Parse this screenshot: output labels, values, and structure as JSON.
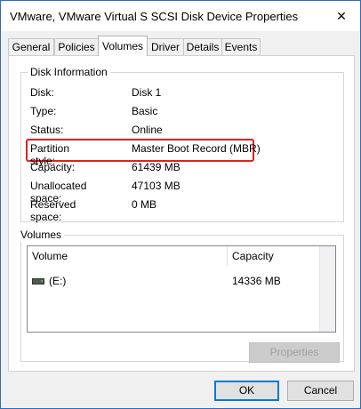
{
  "window": {
    "title": "VMware, VMware Virtual S SCSI Disk Device Properties",
    "close_glyph": "✕"
  },
  "tabs": [
    {
      "label": "General"
    },
    {
      "label": "Policies"
    },
    {
      "label": "Volumes"
    },
    {
      "label": "Driver"
    },
    {
      "label": "Details"
    },
    {
      "label": "Events"
    }
  ],
  "active_tab": "Volumes",
  "disk_info": {
    "heading": "Disk Information",
    "rows": [
      {
        "label": "Disk:",
        "value": "Disk 1"
      },
      {
        "label": "Type:",
        "value": "Basic"
      },
      {
        "label": "Status:",
        "value": "Online"
      },
      {
        "label": "Partition style:",
        "value": "Master Boot Record (MBR)"
      },
      {
        "label": "Capacity:",
        "value": "61439 MB"
      },
      {
        "label": "Unallocated space:",
        "value": "47103 MB"
      },
      {
        "label": "Reserved space:",
        "value": "0 MB"
      }
    ],
    "highlight_color": "#e02020"
  },
  "volumes": {
    "heading": "Volumes",
    "columns": [
      "Volume",
      "Capacity"
    ],
    "rows": [
      {
        "icon": "drive-icon",
        "volume": "(E:)",
        "capacity": "14336 MB"
      }
    ],
    "properties_label": "Properties"
  },
  "footer": {
    "ok_label": "OK",
    "cancel_label": "Cancel"
  },
  "colors": {
    "accent": "#0078d7",
    "window_border": "#2b6cc4"
  }
}
